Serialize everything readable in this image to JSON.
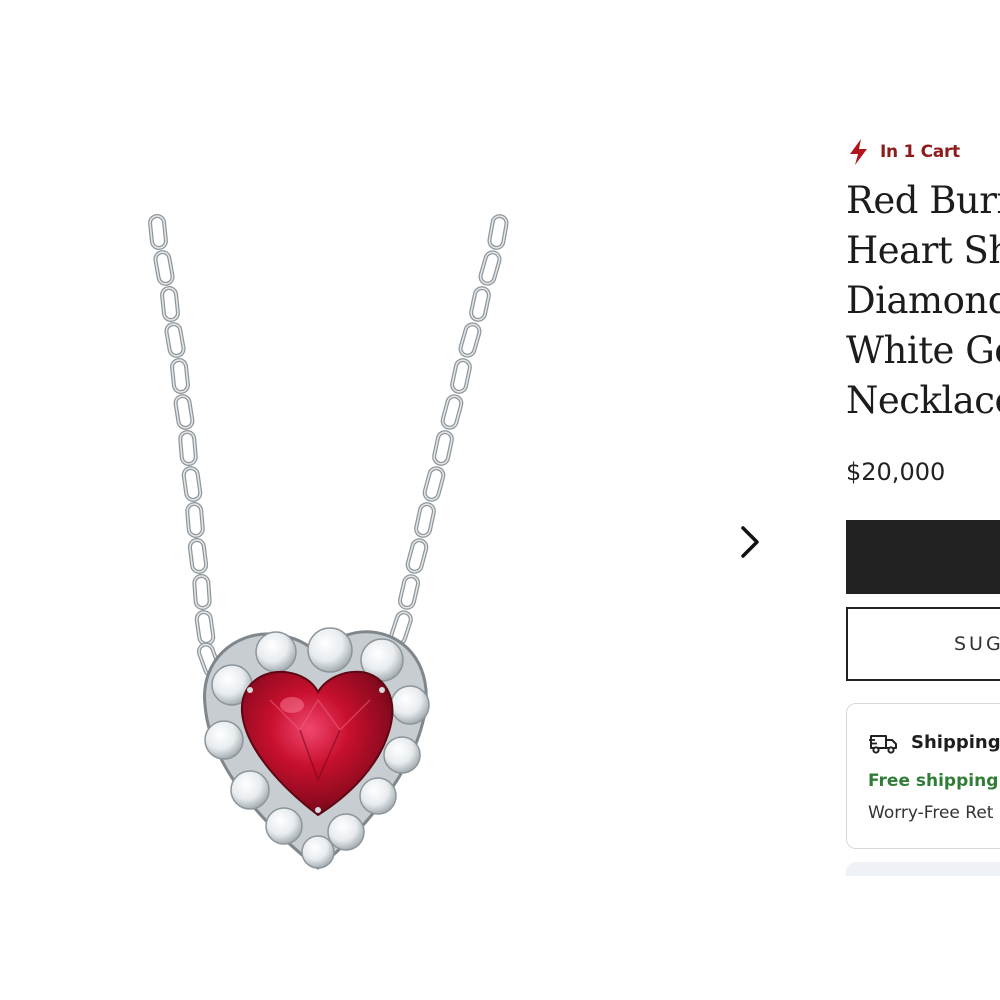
{
  "product_image": {
    "alt": "Red Burmese ruby heart pendant with diamond halo on white gold chain"
  },
  "gallery": {
    "next_icon": "chevron-right-icon"
  },
  "cart_badge": {
    "icon": "bolt-icon",
    "label": "In 1 Cart",
    "color": "#8e1b1b"
  },
  "product": {
    "title_lines": [
      "Red Burm",
      "Heart Sha",
      "Diamond",
      "White Go",
      "Necklace"
    ],
    "price": "$20,000"
  },
  "actions": {
    "primary_label": "",
    "secondary_label": "SUG"
  },
  "shipping": {
    "icon": "truck-icon",
    "title": "Shipping",
    "free_text": "Free shipping",
    "returns_text": "Worry-Free Ret",
    "free_color": "#2f7d36"
  }
}
